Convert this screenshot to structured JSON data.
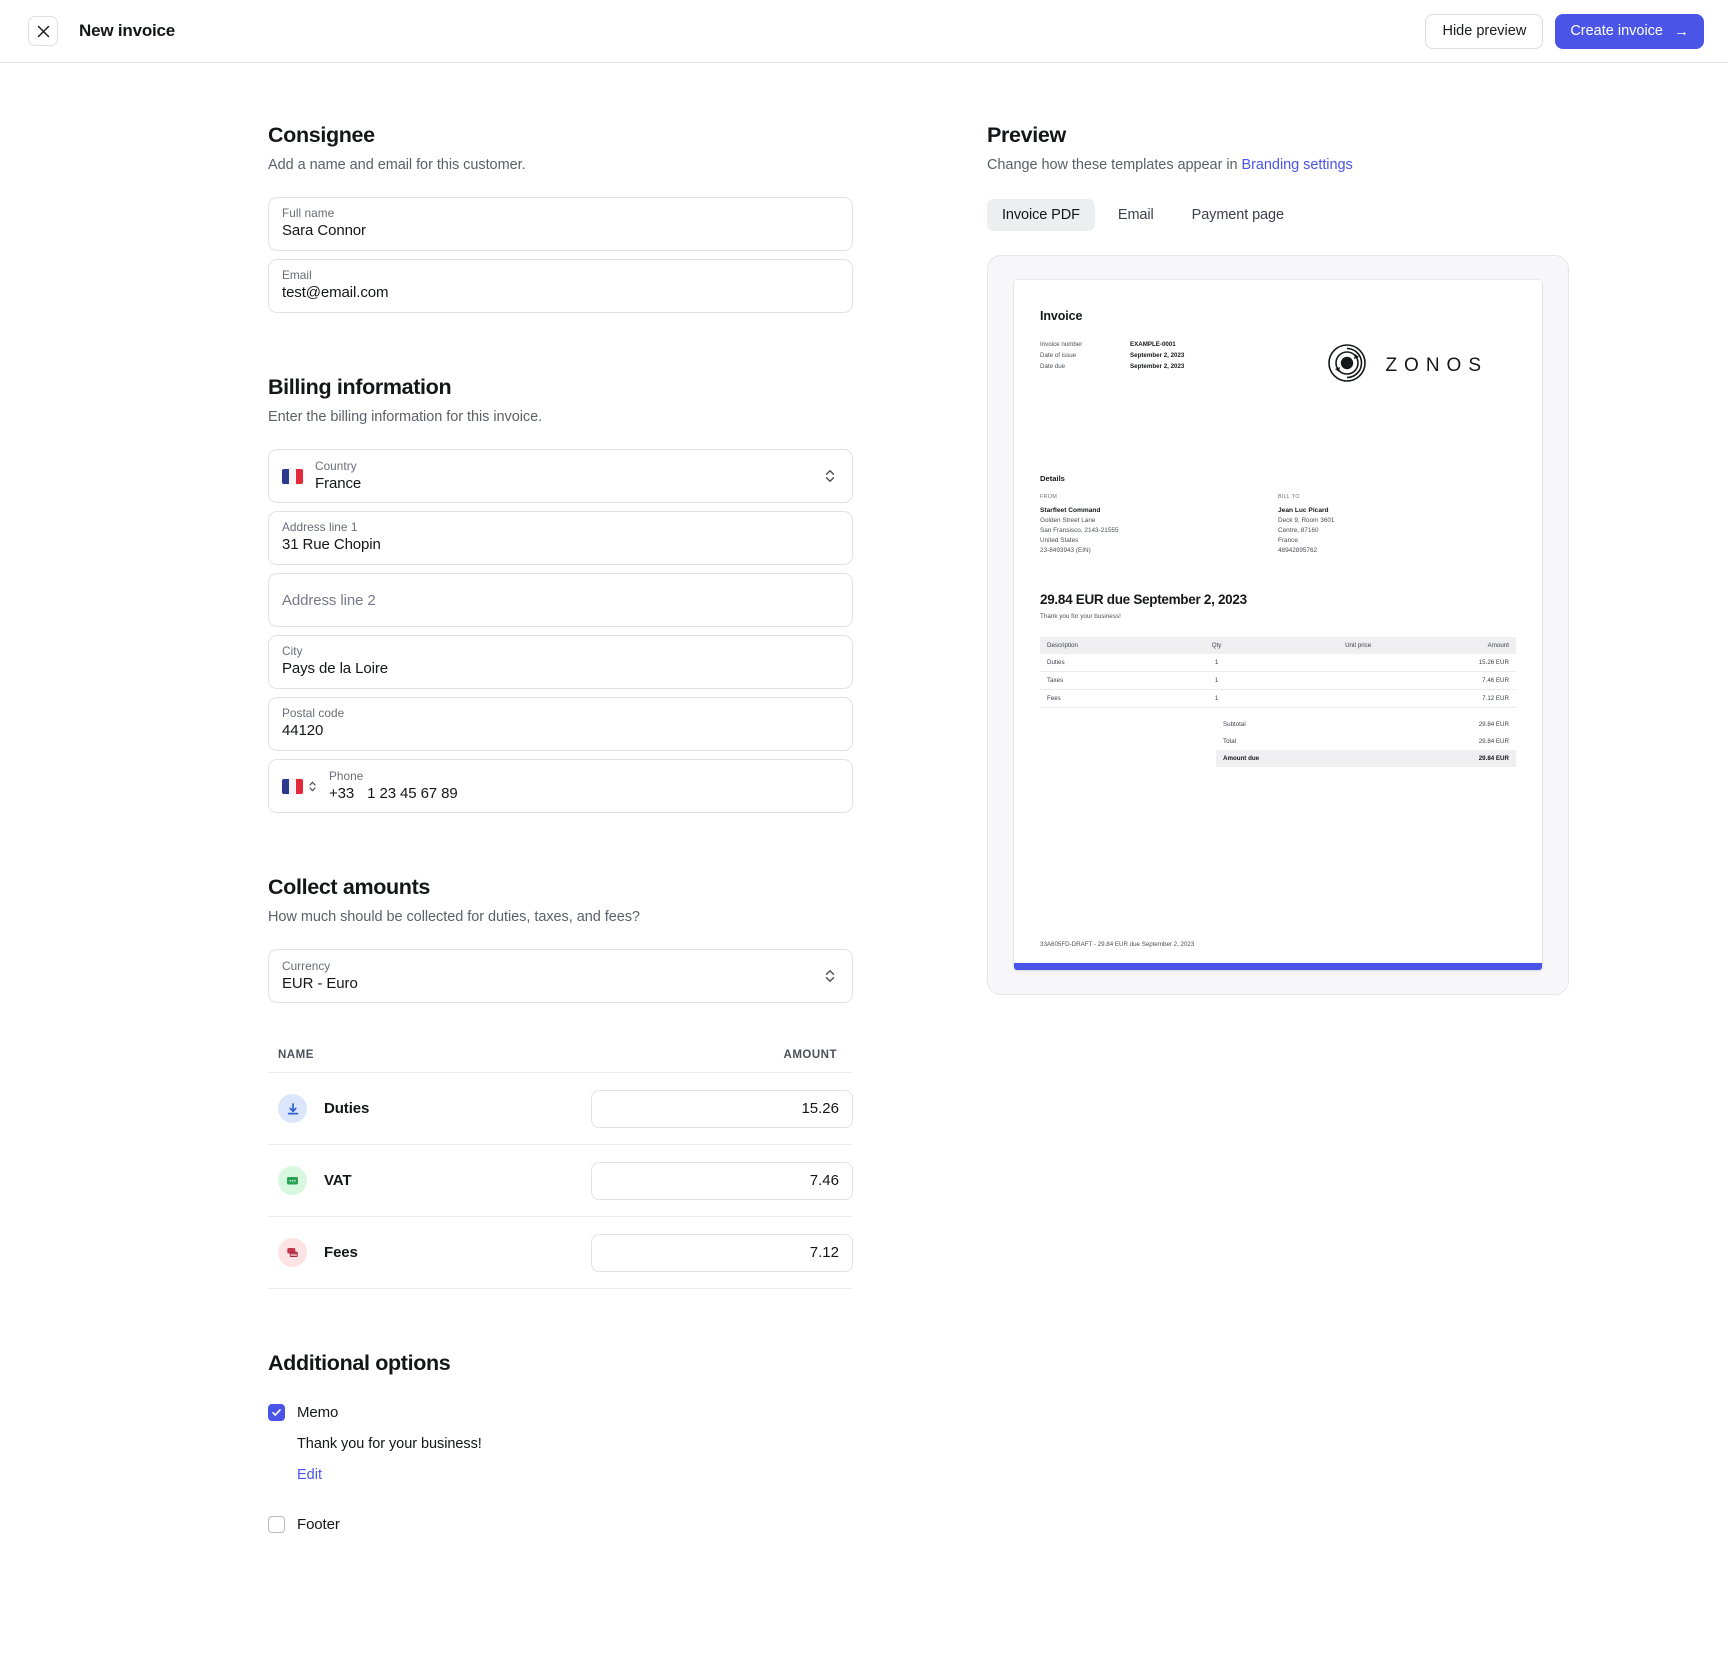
{
  "topbar": {
    "close_icon": "close-icon",
    "title": "New invoice",
    "hide_preview_label": "Hide preview",
    "create_invoice_label": "Create invoice",
    "create_invoice_arrow": "→",
    "accent_color": "#4a55e8"
  },
  "consignee": {
    "title": "Consignee",
    "subtitle": "Add a name and email for this customer.",
    "fields": [
      {
        "label": "Full name",
        "value": "Sara Connor"
      },
      {
        "label": "Email",
        "value": "test@email.com"
      }
    ]
  },
  "billing": {
    "title": "Billing information",
    "subtitle": "Enter the billing information for this invoice.",
    "country": {
      "label": "Country",
      "value": "France",
      "flag": "flag-france-icon"
    },
    "address1": {
      "label": "Address line 1",
      "value": "31 Rue Chopin"
    },
    "address2": {
      "label": "Address line 2",
      "placeholder": "Address line 2",
      "value": ""
    },
    "city": {
      "label": "City",
      "value": "Pays de la Loire"
    },
    "postal": {
      "label": "Postal code",
      "value": "44120"
    },
    "phone": {
      "label": "Phone",
      "dial_code": "+33",
      "value": "1 23 45 67 89",
      "flag": "flag-france-icon"
    }
  },
  "collect": {
    "title": "Collect amounts",
    "subtitle": "How much should be collected for duties, taxes, and fees?",
    "currency": {
      "label": "Currency",
      "value": "EUR - Euro"
    },
    "columns": {
      "name": "NAME",
      "amount": "AMOUNT"
    },
    "rows": [
      {
        "icon": "duties-download-icon",
        "name": "Duties",
        "amount": "15.26",
        "color": "#dbe6fb"
      },
      {
        "icon": "vat-receipt-icon",
        "name": "VAT",
        "amount": "7.46",
        "color": "#d7f7df"
      },
      {
        "icon": "fees-stack-icon",
        "name": "Fees",
        "amount": "7.12",
        "color": "#fde3e3"
      }
    ]
  },
  "additional": {
    "title": "Additional options",
    "memo": {
      "label": "Memo",
      "checked": true,
      "text": "Thank you for your business!",
      "edit_label": "Edit"
    },
    "footer": {
      "label": "Footer",
      "checked": false
    }
  },
  "preview": {
    "title": "Preview",
    "subtitle_prefix": "Change how these templates appear in ",
    "subtitle_link": "Branding settings",
    "tabs": [
      {
        "label": "Invoice PDF",
        "active": true
      },
      {
        "label": "Email",
        "active": false
      },
      {
        "label": "Payment page",
        "active": false
      }
    ],
    "document": {
      "title": "Invoice",
      "meta": [
        {
          "key": "Invoice number",
          "value": "EXAMPLE-0001"
        },
        {
          "key": "Date of issue",
          "value": "September 2, 2023"
        },
        {
          "key": "Date due",
          "value": "September 2, 2023"
        }
      ],
      "brand": "ZONOS",
      "details_title": "Details",
      "from": {
        "label": "FROM",
        "name": "Starfleet Command",
        "lines": [
          "Golden Street Lane",
          "San Fransisco, 2143-21555",
          "United States",
          "23-8493943 (EIN)"
        ]
      },
      "bill_to": {
        "label": "BILL TO",
        "name": "Jean Luc Picard",
        "lines": [
          "Deck 9, Room 3601",
          "Centre, 87160",
          "France",
          "48942895762"
        ]
      },
      "due_heading": "29.84 EUR due September 2, 2023",
      "memo": "Thank you for your business!",
      "table": {
        "headers": [
          "Description",
          "Qty",
          "Unit price",
          "Amount"
        ],
        "rows": [
          {
            "description": "Duties",
            "qty": "1",
            "unit_price": "",
            "amount": "15.26 EUR"
          },
          {
            "description": "Taxes",
            "qty": "1",
            "unit_price": "",
            "amount": "7.46 EUR"
          },
          {
            "description": "Fees",
            "qty": "1",
            "unit_price": "",
            "amount": "7.12 EUR"
          }
        ]
      },
      "totals": [
        {
          "label": "Subtotal",
          "value": "29.84 EUR",
          "strong": false
        },
        {
          "label": "Total",
          "value": "29.84 EUR",
          "strong": false
        },
        {
          "label": "Amount due",
          "value": "29.84 EUR",
          "strong": true
        }
      ],
      "footer": "33A605FD-DRAFT - 29.84 EUR due September 2, 2023"
    }
  }
}
